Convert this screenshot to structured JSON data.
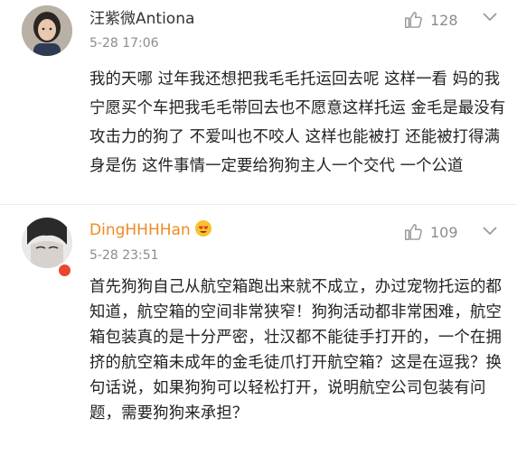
{
  "comments": [
    {
      "username": "汪紫微Antiona",
      "time": "5-28 17:06",
      "likes": "128",
      "text": "我的天哪 过年我还想把我毛毛托运回去呢 这样一看 妈的我宁愿买个车把我毛毛带回去也不愿意这样托运 金毛是最没有攻击力的狗了 不爱叫也不咬人 这样也能被打 还能被打得满身是伤 这件事情一定要给狗狗主人一个交代 一个公道",
      "username_color": "#333333"
    },
    {
      "username": "DingHHHHan",
      "time": "5-28 23:51",
      "likes": "109",
      "text": "首先狗狗自己从航空箱跑出来就不成立，办过宠物托运的都知道，航空箱的空间非常狭窄！狗狗活动都非常困难，航空箱包装真的是十分严密，壮汉都不能徒手打开的，一个在拥挤的航空箱未成年的金毛徒爪打开航空箱？这是在逗我？换句话说，如果狗狗可以轻松打开，说明航空公司包装有问题，需要狗狗来承担？",
      "username_color": "#f08a24",
      "badge_icon": "verified-badge-icon",
      "name_emoji": "heart-eyes-emoji"
    }
  ],
  "icons": {
    "like": "thumbs-up-icon",
    "more": "chevron-down-icon"
  }
}
